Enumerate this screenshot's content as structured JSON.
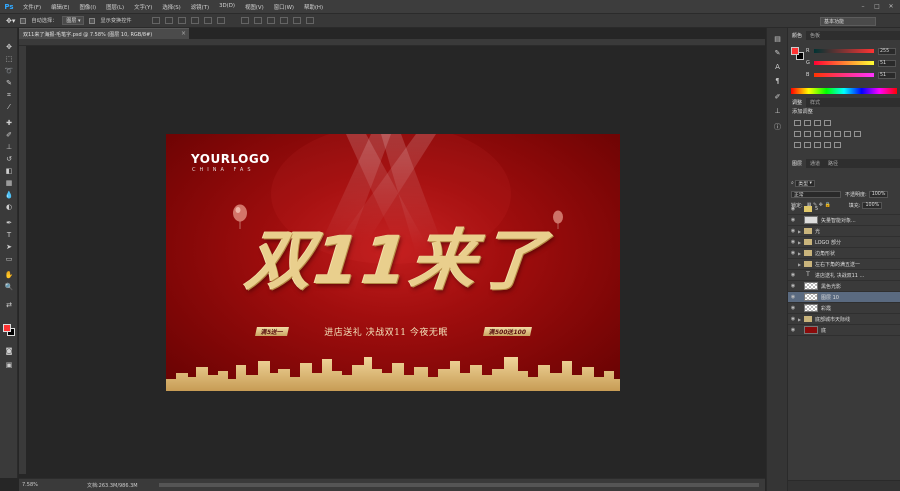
{
  "app": {
    "logo": "Ps"
  },
  "menu": [
    "文件(F)",
    "编辑(E)",
    "图像(I)",
    "图层(L)",
    "文字(Y)",
    "选择(S)",
    "滤镜(T)",
    "3D(D)",
    "视图(V)",
    "窗口(W)",
    "帮助(H)"
  ],
  "window_controls": {
    "minimize": "–",
    "maximize": "□",
    "close": "✕"
  },
  "options": {
    "auto_select_label": "自动选择：",
    "auto_select_value": "图层",
    "show_transform_label": "显示变换控件",
    "workspace": "基本功能"
  },
  "document": {
    "tab_title": "双11来了海报-毛笔字.psd @ 7.58% (图层 10, RGB/8#)",
    "zoom": "7.58%",
    "doc_size": "文档:263.3M/986.3M"
  },
  "artwork": {
    "logo": "YOURLOGO",
    "logo_sub": "CHINA FAS",
    "headline": "双11来了",
    "pill_left": "满5送一",
    "slogan": "进店送礼  决战双11  今夜无眠",
    "pill_right": "满500送100"
  },
  "color_panel": {
    "tabs": [
      "颜色",
      "色板"
    ],
    "fg_color": "#ff3333",
    "bg_color": "#000000",
    "r_label": "R",
    "r_value": "255",
    "g_label": "G",
    "g_value": "51",
    "b_label": "B",
    "b_value": "51"
  },
  "adjustments_panel": {
    "tabs": [
      "调整",
      "样式"
    ],
    "title": "添加调整"
  },
  "layers_panel": {
    "tabs": [
      "图层",
      "通道",
      "路径"
    ],
    "kind_filter": "类型",
    "blend_mode": "正常",
    "opacity_label": "不透明度:",
    "opacity_value": "100%",
    "lock_label": "锁定:",
    "fill_label": "填充:",
    "fill_value": "100%",
    "layers": [
      {
        "name": "5",
        "type": "folder-thumb",
        "visible": true,
        "selected": false
      },
      {
        "name": "矢量智能对象...",
        "type": "smart",
        "visible": true,
        "selected": false
      },
      {
        "name": "光",
        "type": "folder",
        "visible": true,
        "selected": false
      },
      {
        "name": "LOGO 部分",
        "type": "folder",
        "visible": true,
        "selected": false
      },
      {
        "name": "边角形状",
        "type": "folder",
        "visible": true,
        "selected": false
      },
      {
        "name": "左右下角的满五送一",
        "type": "folder",
        "visible": false,
        "selected": false
      },
      {
        "name": "进店送礼  决战双11 ...",
        "type": "text",
        "visible": true,
        "selected": false
      },
      {
        "name": "黑色光影",
        "type": "pixel",
        "visible": true,
        "selected": false
      },
      {
        "name": "图层 10",
        "type": "pixel",
        "visible": true,
        "selected": true
      },
      {
        "name": "彩霞",
        "type": "pixel",
        "visible": true,
        "selected": false
      },
      {
        "name": "底部城市天际线",
        "type": "folder",
        "visible": true,
        "selected": false
      },
      {
        "name": "底",
        "type": "red",
        "visible": true,
        "selected": false
      }
    ]
  }
}
